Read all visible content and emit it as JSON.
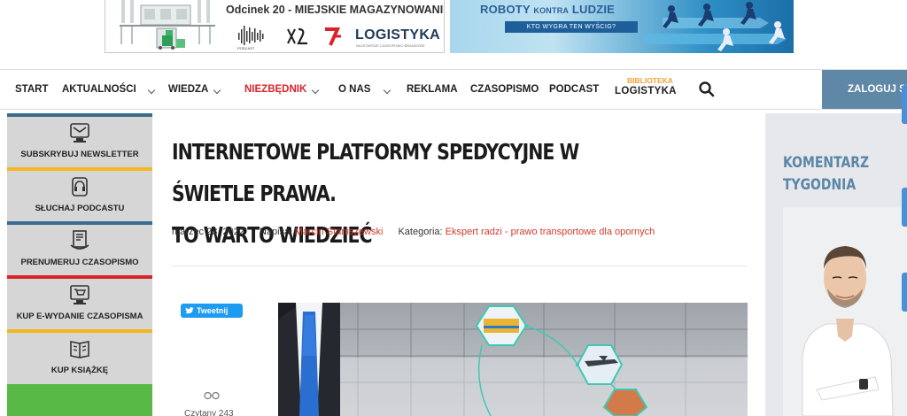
{
  "banners": {
    "left": {
      "episode_title": "Odcinek 20 - MIEJSKIE MAGAZYNOWANIE",
      "podcast_label": "PODCAST",
      "logo_text": "LOGISTYKA",
      "logo_sub": "NAJSTARSZE CZASOPISMO BRANŻOWE"
    },
    "right": {
      "title_word_1": "ROBOTY",
      "title_word_2": "KONTRA",
      "title_word_3": "LUDZIE",
      "subtitle": "KTO WYGRA TEN WYŚCIG?"
    }
  },
  "nav": {
    "items": [
      {
        "label": "START"
      },
      {
        "label": "AKTUALNOŚCI"
      },
      {
        "label": "WIEDZA"
      },
      {
        "label": "NIEZBĘDNIK"
      },
      {
        "label": "O NAS"
      },
      {
        "label": "REKLAMA"
      },
      {
        "label": "CZASOPISMO"
      },
      {
        "label": "PODCAST"
      }
    ],
    "biblioteka_top": "BIBLIOTEKA",
    "biblioteka_bottom": "LOGISTYKA",
    "login_label": "ZALOGUJ SIĘ"
  },
  "sidebar": {
    "items": [
      {
        "label": "SUBSKRYBUJ NEWSLETTER",
        "icon": "newsletter-icon",
        "color": "#3a6b8c"
      },
      {
        "label": "SŁUCHAJ PODCASTU",
        "icon": "podcast-icon",
        "color": "#f3b81f"
      },
      {
        "label": "PRENUMERUJ CZASOPISMO",
        "icon": "magazine-icon",
        "color": "#3a6b8c"
      },
      {
        "label": "KUP E-WYDANIE CZASOPISMA",
        "icon": "cart-icon",
        "color": "#d8232a"
      },
      {
        "label": "KUP KSIĄŻKĘ",
        "icon": "book-icon",
        "color": "#f3b81f"
      }
    ],
    "green_color": "#58b947"
  },
  "article": {
    "title_line_1": "INTERNETOWE PLATFORMY SPEDYCYJNE W ŚWIETLE PRAWA.",
    "title_line_2": "TO WARTO WIEDZIEĆ",
    "date": "marzec 23, 2022",
    "author_prefix": "Napisał",
    "author": "Marcin Staniszewski",
    "category_prefix": "Kategoria:",
    "category": "Ekspert radzi - prawo transportowe dla opornych",
    "tweet_label": "Tweetnij",
    "reads": "Czytany 243"
  },
  "right": {
    "title_line_1": "KOMENTARZ",
    "title_line_2": "TYGODNIA"
  },
  "colors": {
    "accent_blue": "#5f87a6",
    "accent_red": "#d8232a",
    "link_red": "#d23b2c",
    "tweet_blue": "#1d9bf0"
  }
}
